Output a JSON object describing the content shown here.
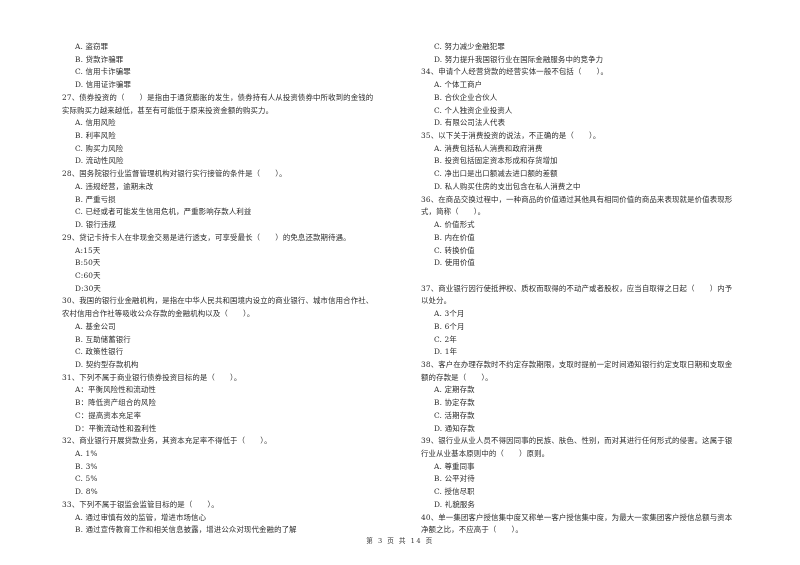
{
  "left_column": [
    {
      "type": "opt",
      "text": "A. 盗窃罪"
    },
    {
      "type": "opt",
      "text": "B. 贷款诈骗罪"
    },
    {
      "type": "opt",
      "text": "C. 信用卡诈骗罪"
    },
    {
      "type": "opt",
      "text": "D. 信用证诈骗罪"
    },
    {
      "type": "stem",
      "text": "27、债券投资的（　　）是指由于通货膨胀的发生，债券持有人从投资债券中所收到的金钱的"
    },
    {
      "type": "stem-cont",
      "text": "实际购买力越来越低，甚至有可能低于原来投资金额的购买力。"
    },
    {
      "type": "opt",
      "text": "A. 信用风险"
    },
    {
      "type": "opt",
      "text": "B. 利率风险"
    },
    {
      "type": "opt",
      "text": "C. 购买力风险"
    },
    {
      "type": "opt",
      "text": "D. 流动性风险"
    },
    {
      "type": "stem",
      "text": "28、国务院银行业监督管理机构对银行实行接管的条件是（　　）。"
    },
    {
      "type": "opt",
      "text": "A. 违规经营，逾期未改"
    },
    {
      "type": "opt",
      "text": "B. 严重亏损"
    },
    {
      "type": "opt",
      "text": "C. 已经或者可能发生信用危机，严重影响存款人利益"
    },
    {
      "type": "opt",
      "text": "D. 银行违规"
    },
    {
      "type": "stem",
      "text": "29、贷记卡持卡人在非现金交易是进行透支，可享受最长（　　）的免息还款期待遇。"
    },
    {
      "type": "opt",
      "text": "A:15天"
    },
    {
      "type": "opt",
      "text": "B:50天"
    },
    {
      "type": "opt",
      "text": "C:60天"
    },
    {
      "type": "opt",
      "text": "D:30天"
    },
    {
      "type": "stem",
      "text": "30、我国的银行业金融机构，是指在中华人民共和国境内设立的商业银行、城市信用合作社、"
    },
    {
      "type": "stem-cont",
      "text": "农村信用合作社等吸收公众存款的金融机构以及（　　）。"
    },
    {
      "type": "opt",
      "text": "A. 基金公司"
    },
    {
      "type": "opt",
      "text": "B. 互助储蓄银行"
    },
    {
      "type": "opt",
      "text": "C. 政策性银行"
    },
    {
      "type": "opt",
      "text": "D. 契约型存款机构"
    },
    {
      "type": "stem",
      "text": "31、下列不属于商业银行债券投资目标的是（　　）。"
    },
    {
      "type": "opt",
      "text": "A：平衡风险性和流动性"
    },
    {
      "type": "opt",
      "text": "B：降低资产组合的风险"
    },
    {
      "type": "opt",
      "text": "C：提高资本充足率"
    },
    {
      "type": "opt",
      "text": "D：平衡流动性和盈利性"
    },
    {
      "type": "stem",
      "text": "32、商业银行开展贷款业务，其资本充足率不得低于（　　）。"
    },
    {
      "type": "opt",
      "text": "A. 1%"
    },
    {
      "type": "opt",
      "text": "B. 3%"
    },
    {
      "type": "opt",
      "text": "C. 5%"
    },
    {
      "type": "opt",
      "text": "D. 8%"
    },
    {
      "type": "stem",
      "text": "33、下列不属于银监会监管目标的是（　　）。"
    },
    {
      "type": "opt",
      "text": "A. 通过审慎有效的监管，增进市场信心"
    },
    {
      "type": "opt",
      "text": "B. 通过宣传教育工作和相关信息披露，增进公众对现代金融的了解"
    }
  ],
  "right_column": [
    {
      "type": "opt",
      "text": "C. 努力减少金融犯罪"
    },
    {
      "type": "opt",
      "text": "D. 努力提升我国银行业在国际金融服务中的竞争力"
    },
    {
      "type": "stem",
      "text": "34、申请个人经营贷款的经营实体一般不包括（　　）。"
    },
    {
      "type": "opt",
      "text": "A. 个体工商户"
    },
    {
      "type": "opt",
      "text": "B. 合伙企业合伙人"
    },
    {
      "type": "opt",
      "text": "C. 个人独资企业投资人"
    },
    {
      "type": "opt",
      "text": "D. 有限公司法人代表"
    },
    {
      "type": "stem",
      "text": "35、以下关于消费投资的说法，不正确的是（　　）。"
    },
    {
      "type": "opt",
      "text": "A. 消费包括私人消费和政府消费"
    },
    {
      "type": "opt",
      "text": "B. 投资包括固定资本形成和存货增加"
    },
    {
      "type": "opt",
      "text": "C. 净出口是出口额减去进口额的差额"
    },
    {
      "type": "opt",
      "text": "D. 私人购买住房的支出包含在私人消费之中"
    },
    {
      "type": "stem",
      "text": "36、在商品交换过程中，一种商品的价值通过其他具有相同价值的商品来表现就是价值表现形"
    },
    {
      "type": "stem-cont",
      "text": "式，简称（　　）。"
    },
    {
      "type": "opt",
      "text": "A. 价值形式"
    },
    {
      "type": "opt",
      "text": "B. 内在价值"
    },
    {
      "type": "opt",
      "text": "C. 转换价值"
    },
    {
      "type": "opt",
      "text": "D. 使用价值"
    },
    {
      "type": "blank",
      "text": ""
    },
    {
      "type": "stem",
      "text": "37、商业银行因行使抵押权、质权而取得的不动产或者股权，应当自取得之日起（　　）内予"
    },
    {
      "type": "stem-cont",
      "text": "以处分。"
    },
    {
      "type": "opt",
      "text": "A. 3个月"
    },
    {
      "type": "opt",
      "text": "B. 6个月"
    },
    {
      "type": "opt",
      "text": "C. 2年"
    },
    {
      "type": "opt",
      "text": "D. 1年"
    },
    {
      "type": "stem",
      "text": "38、客户在办理存款时不约定存款期限，支取时提前一定时间通知银行约定支取日期和支取金"
    },
    {
      "type": "stem-cont",
      "text": "额的存款是（　　）。"
    },
    {
      "type": "opt",
      "text": "A. 定期存款"
    },
    {
      "type": "opt",
      "text": "B. 协定存款"
    },
    {
      "type": "opt",
      "text": "C. 活期存款"
    },
    {
      "type": "opt",
      "text": "D. 通知存款"
    },
    {
      "type": "stem",
      "text": "39、银行业从业人员不得因同事的民族、肤色、性别，而对其进行任何形式的侵害。这属于银"
    },
    {
      "type": "stem-cont",
      "text": "行业从业基本原则中的（　　）原则。"
    },
    {
      "type": "opt",
      "text": "A. 尊重同事"
    },
    {
      "type": "opt",
      "text": "B. 公平对待"
    },
    {
      "type": "opt",
      "text": "C. 授信尽职"
    },
    {
      "type": "opt",
      "text": "D. 礼貌服务"
    },
    {
      "type": "stem",
      "text": "40、单一集团客户授信集中度又称单一客户授信集中度，为最大一家集团客户授信总额与资本"
    },
    {
      "type": "stem-cont",
      "text": "净额之比，不应高于（　　）。"
    }
  ],
  "footer": {
    "page_label": "第 3 页 共 14 页",
    "current_page": 3,
    "total_pages": 14
  }
}
